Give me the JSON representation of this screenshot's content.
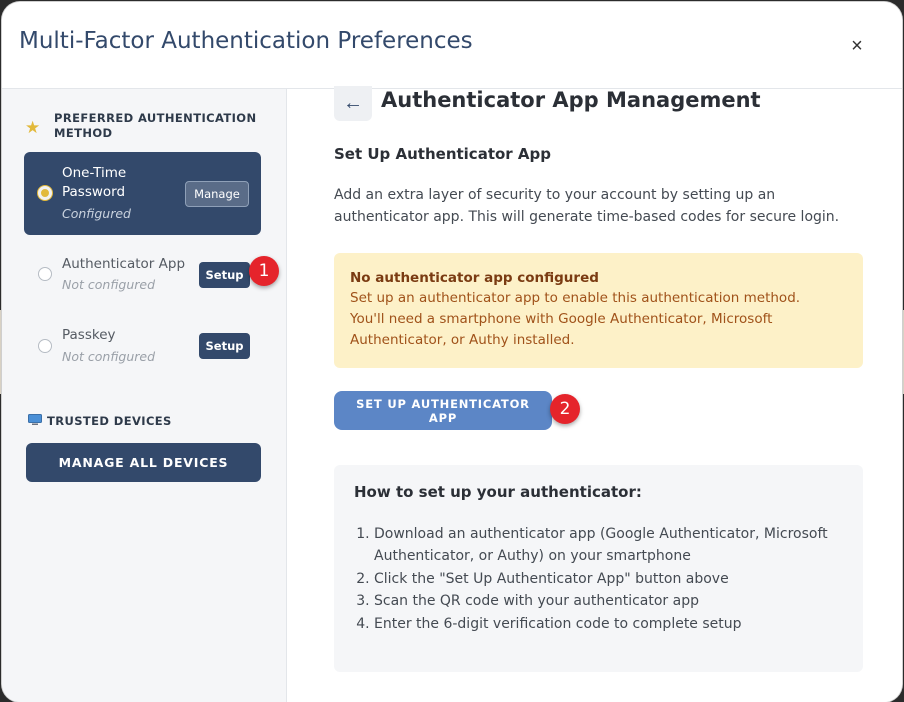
{
  "modal": {
    "title": "Multi-Factor Authentication Preferences",
    "close_label": "×"
  },
  "sidebar": {
    "preferred_heading_line1": "PREFERRED AUTHENTICATION",
    "preferred_heading_line2": "METHOD",
    "methods": [
      {
        "name_line1": "One-Time",
        "name_line2": "Password",
        "status": "Configured",
        "action": "Manage",
        "selected": true
      },
      {
        "name": "Authenticator App",
        "status": "Not configured",
        "action": "Setup",
        "selected": false
      },
      {
        "name": "Passkey",
        "status": "Not configured",
        "action": "Setup",
        "selected": false
      }
    ],
    "trusted_heading": "TRUSTED DEVICES",
    "manage_devices_label": "MANAGE ALL DEVICES"
  },
  "main": {
    "back_label": "←",
    "title": "Authenticator App Management",
    "subtitle": "Set Up Authenticator App",
    "description": "Add an extra layer of security to your account by setting up an authenticator app. This will generate time-based codes for secure login.",
    "alert": {
      "title": "No authenticator app configured",
      "text_line1": "Set up an authenticator app to enable this authentication method.",
      "text_line2": "You'll need a smartphone with Google Authenticator, Microsoft",
      "text_line3": "Authenticator, or Authy installed."
    },
    "primary_button_label": "SET UP AUTHENTICATOR APP",
    "howto": {
      "title": "How to set up your authenticator:",
      "steps": [
        "Download an authenticator app (Google Authenticator, Microsoft Authenticator, or Authy) on your smartphone",
        "Click the \"Set Up Authenticator App\" button above",
        "Scan the QR code with your authenticator app",
        "Enter the 6-digit verification code to complete setup"
      ]
    }
  },
  "annotations": {
    "badge1": "1",
    "badge2": "2"
  },
  "colors": {
    "navy": "#33496b",
    "primary_blue": "#5c86c6",
    "gold": "#e2b93b",
    "alert_bg": "#fdf1c8",
    "badge_red": "#e5242b"
  }
}
